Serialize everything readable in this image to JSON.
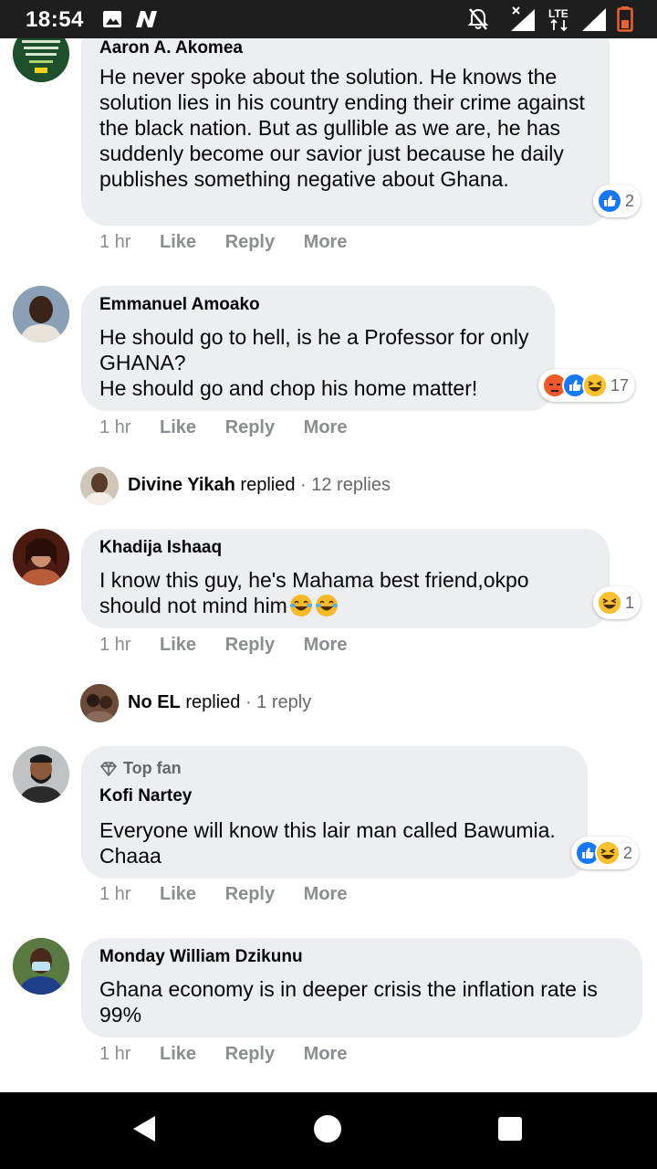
{
  "status_bar": {
    "time": "18:54",
    "left_icons": [
      "image-icon",
      "n-app-icon"
    ],
    "right_icons": [
      "mute-bell-icon",
      "signal-x-icon",
      "lte-icon",
      "signal-icon",
      "battery-icon"
    ],
    "lte_label": "LTE"
  },
  "comments": [
    {
      "author": "Aaron A. Akomea",
      "text": "He never spoke about the solution. He knows the solution lies in his country ending their crime against the black nation. But as gullible as we are, he has suddenly become our savior just because he daily publishes something negative about Ghana.",
      "reactions": [
        "like"
      ],
      "reaction_count": "2",
      "time": "1 hr",
      "like": "Like",
      "reply": "Reply",
      "more": "More"
    },
    {
      "author": "Emmanuel Amoako",
      "lines": [
        "He should go to hell, is he a Professor for only GHANA?",
        "He should go and chop his home matter!"
      ],
      "reactions": [
        "angry",
        "like",
        "haha"
      ],
      "reaction_count": "17",
      "time": "1 hr",
      "like": "Like",
      "reply": "Reply",
      "more": "More",
      "replies": {
        "name": "Divine Yikah",
        "verb": "replied",
        "count": "· 12 replies"
      }
    },
    {
      "author": "Khadija Ishaaq",
      "text": "I know this guy, he's Mahama best friend,okpo should not mind him",
      "reactions": [
        "haha"
      ],
      "reaction_count": "1",
      "time": "1 hr",
      "like": "Like",
      "reply": "Reply",
      "more": "More",
      "replies": {
        "name": "No EL",
        "verb": "replied",
        "count": "· 1 reply"
      }
    },
    {
      "badge": "Top fan",
      "author": "Kofi Nartey",
      "text": "Everyone will know this lair man called Bawumia. Chaaa",
      "reactions": [
        "like",
        "haha"
      ],
      "reaction_count": "2",
      "time": "1 hr",
      "like": "Like",
      "reply": "Reply",
      "more": "More"
    },
    {
      "author": "Monday William Dzikunu",
      "text": "Ghana economy is in deeper crisis the inflation rate is 99%",
      "time": "1 hr",
      "like": "Like",
      "reply": "Reply",
      "more": "More"
    }
  ],
  "nav_bar": {
    "buttons": [
      "back-icon",
      "home-icon",
      "recents-icon"
    ]
  },
  "colors": {
    "bubble": "#eceef1",
    "meta": "#8a8d91",
    "like_blue": "#1877f2",
    "status_bar": "#1e1e1e"
  }
}
